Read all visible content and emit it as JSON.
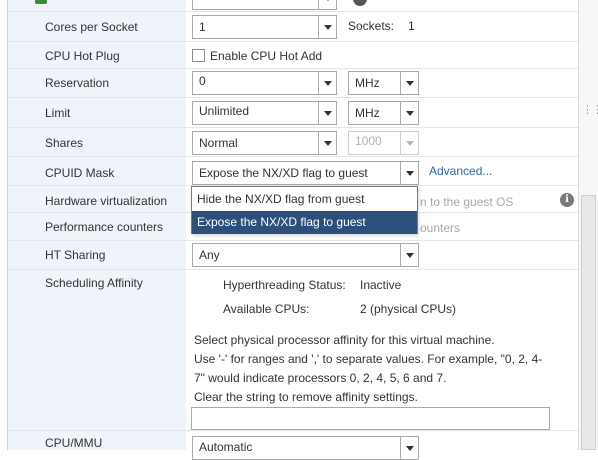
{
  "rows": {
    "cores_per_socket": {
      "label": "Cores per Socket",
      "value": "1",
      "sockets_label": "Sockets:",
      "sockets_value": "1"
    },
    "cpu_hot_plug": {
      "label": "CPU Hot Plug",
      "checkbox_label": "Enable CPU Hot Add",
      "checked": false
    },
    "reservation": {
      "label": "Reservation",
      "value": "0",
      "unit": "MHz"
    },
    "limit": {
      "label": "Limit",
      "value": "Unlimited",
      "unit": "MHz"
    },
    "shares": {
      "label": "Shares",
      "value": "Normal",
      "amount": "1000"
    },
    "cpuid_mask": {
      "label": "CPUID Mask",
      "value": "Expose the NX/XD flag to guest",
      "advanced_link": "Advanced..."
    },
    "hardware_virtualization": {
      "label": "Hardware virtualization",
      "hidden_text": "n to the guest OS"
    },
    "performance_counters": {
      "label": "Performance counters",
      "hidden_text": "ounters"
    },
    "ht_sharing": {
      "label": "HT Sharing",
      "value": "Any"
    },
    "scheduling_affinity": {
      "label": "Scheduling Affinity",
      "ht_status_label": "Hyperthreading Status:",
      "ht_status_value": "Inactive",
      "available_cpus_label": "Available CPUs:",
      "available_cpus_value": "2 (physical CPUs)",
      "help_line1": "Select physical processor affinity for this virtual machine.",
      "help_line2": "Use '-' for ranges and ',' to separate values. For example,  \"0, 2, 4-",
      "help_line3": "7\" would indicate processors 0, 2, 4, 5, 6 and 7.",
      "help_line4": "Clear the string to remove affinity settings.",
      "affinity_value": ""
    },
    "cpu_mmu": {
      "label": "CPU/MMU",
      "value": "Automatic"
    }
  },
  "cpuid_dropdown": {
    "options": [
      "Hide the NX/XD flag from guest",
      "Expose the NX/XD flag to guest"
    ],
    "selected_index": 1
  }
}
